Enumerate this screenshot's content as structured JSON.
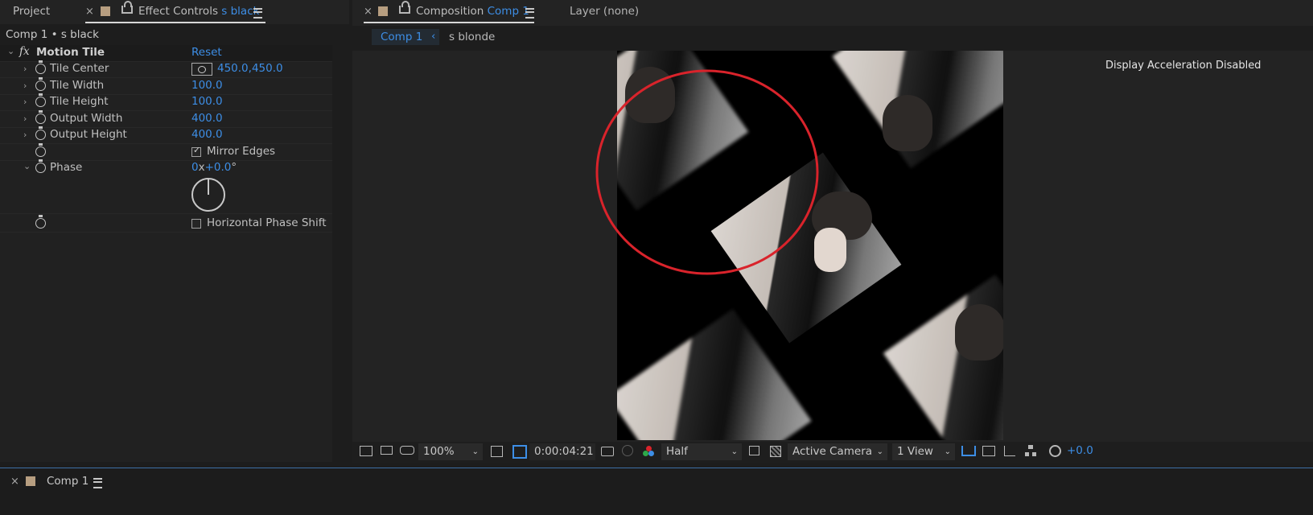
{
  "left_panel": {
    "tabs": {
      "project": "Project",
      "close": "×",
      "effect_controls": "Effect Controls",
      "effect_layer": "s black"
    },
    "breadcrumb": "Comp 1 • s black",
    "effect": {
      "fx": "fx",
      "name": "Motion Tile",
      "reset": "Reset"
    },
    "properties": [
      {
        "name": "Tile Center",
        "value": "450.0,450.0"
      },
      {
        "name": "Tile Width",
        "value": "100.0"
      },
      {
        "name": "Tile Height",
        "value": "100.0"
      },
      {
        "name": "Output Width",
        "value": "400.0"
      },
      {
        "name": "Output Height",
        "value": "400.0"
      }
    ],
    "mirror_edges": {
      "label": "Mirror Edges",
      "checked": true
    },
    "phase": {
      "name": "Phase",
      "revolutions": "0",
      "x": "x",
      "degrees": "+0.0",
      "deg": "°"
    },
    "horizontal_phase_shift": {
      "label": "Horizontal Phase Shift",
      "checked": false
    }
  },
  "composition_panel": {
    "close": "×",
    "tab_prefix": "Composition",
    "tab_comp": "Comp 1",
    "layer_tab": "Layer  (none)",
    "breadcrumb_active": "Comp 1",
    "breadcrumb_next": "s blonde",
    "overlay_text": "Display Acceleration Disabled"
  },
  "viewer_toolbar": {
    "zoom": "100%",
    "timecode": "0:00:04:21",
    "resolution": "Half",
    "camera": "Active Camera",
    "views": "1 View",
    "exposure": "+0.0"
  },
  "timeline_panel": {
    "close": "×",
    "tab": "Comp 1"
  },
  "colors": {
    "accent": "#3d8ee6",
    "annotation_circle": "#d9232b",
    "label_swatch": "#b79e80"
  }
}
